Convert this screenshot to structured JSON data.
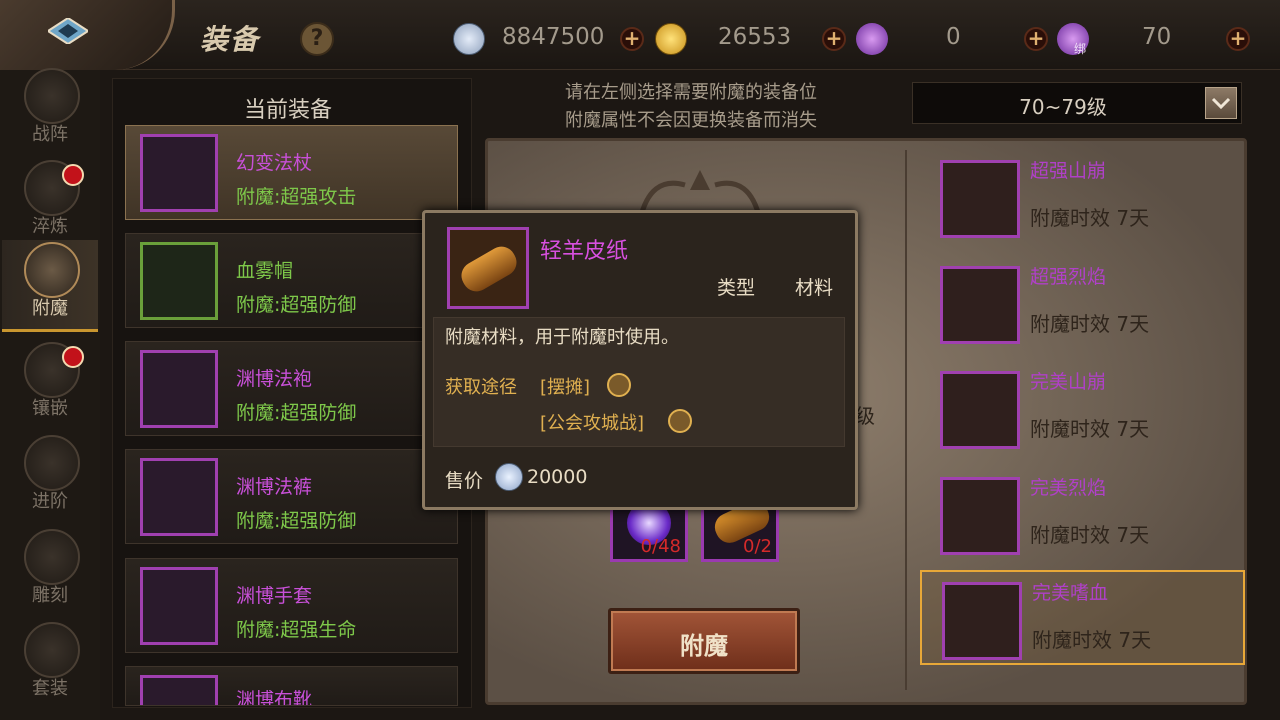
{
  "header": {
    "title": "装备",
    "help": "?",
    "currencies": [
      {
        "icon": "silver-coin-icon",
        "value": "8847500"
      },
      {
        "icon": "gold-coin-icon",
        "value": "26553"
      },
      {
        "icon": "purple-gem-icon",
        "value": "0"
      },
      {
        "icon": "bound-purple-gem-icon",
        "value": "70",
        "badge": "绑"
      }
    ],
    "plus": "+"
  },
  "sidenav": [
    {
      "label": "战阵",
      "badge": false,
      "active": false
    },
    {
      "label": "淬炼",
      "badge": true,
      "active": false
    },
    {
      "label": "附魔",
      "badge": false,
      "active": true
    },
    {
      "label": "镶嵌",
      "badge": true,
      "active": false
    },
    {
      "label": "进阶",
      "badge": false,
      "active": false
    },
    {
      "label": "雕刻",
      "badge": false,
      "active": false
    },
    {
      "label": "套装",
      "badge": false,
      "active": false
    }
  ],
  "equipment": {
    "title": "当前装备",
    "items": [
      {
        "name": "幻变法杖",
        "enchant": "附魔:超强攻击",
        "selected": true
      },
      {
        "name": "血雾帽",
        "enchant": "附魔:超强防御",
        "selected": false
      },
      {
        "name": "渊博法袍",
        "enchant": "附魔:超强防御",
        "selected": false
      },
      {
        "name": "渊博法裤",
        "enchant": "附魔:超强防御",
        "selected": false
      },
      {
        "name": "渊博手套",
        "enchant": "附魔:超强生命",
        "selected": false
      },
      {
        "name": "渊博布靴",
        "enchant": "",
        "selected": false
      }
    ]
  },
  "hints": {
    "line1": "请在左侧选择需要附魔的装备位",
    "line2": "附魔属性不会因更换装备而消失"
  },
  "level_select": {
    "value": "70~79级"
  },
  "scrolls": [
    {
      "name": "超强山崩",
      "duration": "附魔时效 7天"
    },
    {
      "name": "超强烈焰",
      "duration": "附魔时效 7天"
    },
    {
      "name": "完美山崩",
      "duration": "附魔时效 7天"
    },
    {
      "name": "完美烈焰",
      "duration": "附魔时效 7天"
    },
    {
      "name": "完美嗜血",
      "duration": "附魔时效 7天"
    }
  ],
  "materials": [
    {
      "count": "0/48"
    },
    {
      "count": "0/2"
    }
  ],
  "ghost_text": "级",
  "enchant_button": "附魔",
  "tooltip": {
    "name": "轻羊皮纸",
    "type_label": "类型",
    "type_value": "材料",
    "description": "附魔材料，用于附魔时使用。",
    "source_label": "获取途径",
    "sources": [
      "[摆摊]",
      "[公会攻城战]"
    ],
    "price_label": "售价",
    "price_value": "20000"
  },
  "colors": {
    "purple_quality": "#a040b0",
    "green_text": "#7ec84a",
    "gold_text": "#e0b050"
  }
}
